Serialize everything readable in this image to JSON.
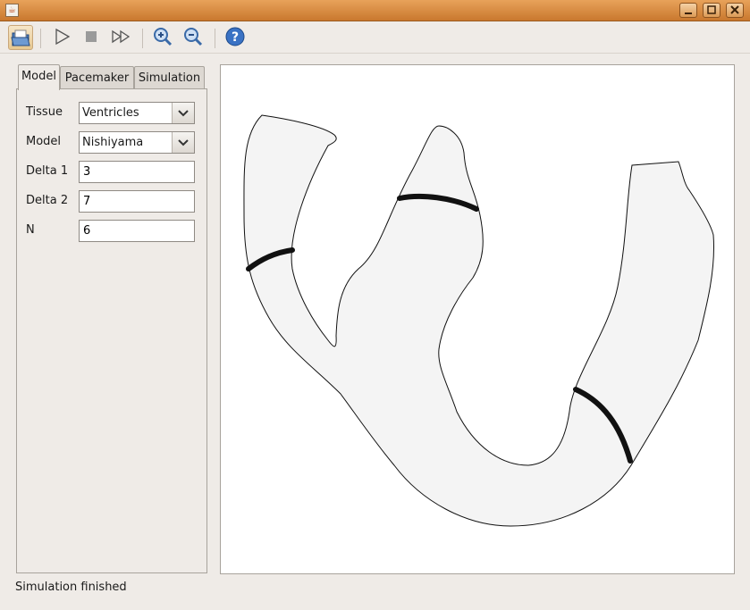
{
  "window": {
    "app_icon": "java-icon",
    "controls": [
      "minimize-icon",
      "maximize-icon",
      "close-icon"
    ]
  },
  "toolbar": {
    "icons": [
      "open-folder-icon",
      "play-icon",
      "stop-icon",
      "fast-forward-icon",
      "zoom-in-icon",
      "zoom-out-icon",
      "help-icon"
    ]
  },
  "tabs": [
    "Model",
    "Pacemaker",
    "Simulation"
  ],
  "form": {
    "tissue_label": "Tissue",
    "tissue_value": "Ventricles",
    "model_label": "Model",
    "model_value": "Nishiyama",
    "delta1_label": "Delta 1",
    "delta1_value": "3",
    "delta2_label": "Delta 2",
    "delta2_value": "7",
    "n_label": "N",
    "n_value": "6"
  },
  "status": "Simulation finished"
}
